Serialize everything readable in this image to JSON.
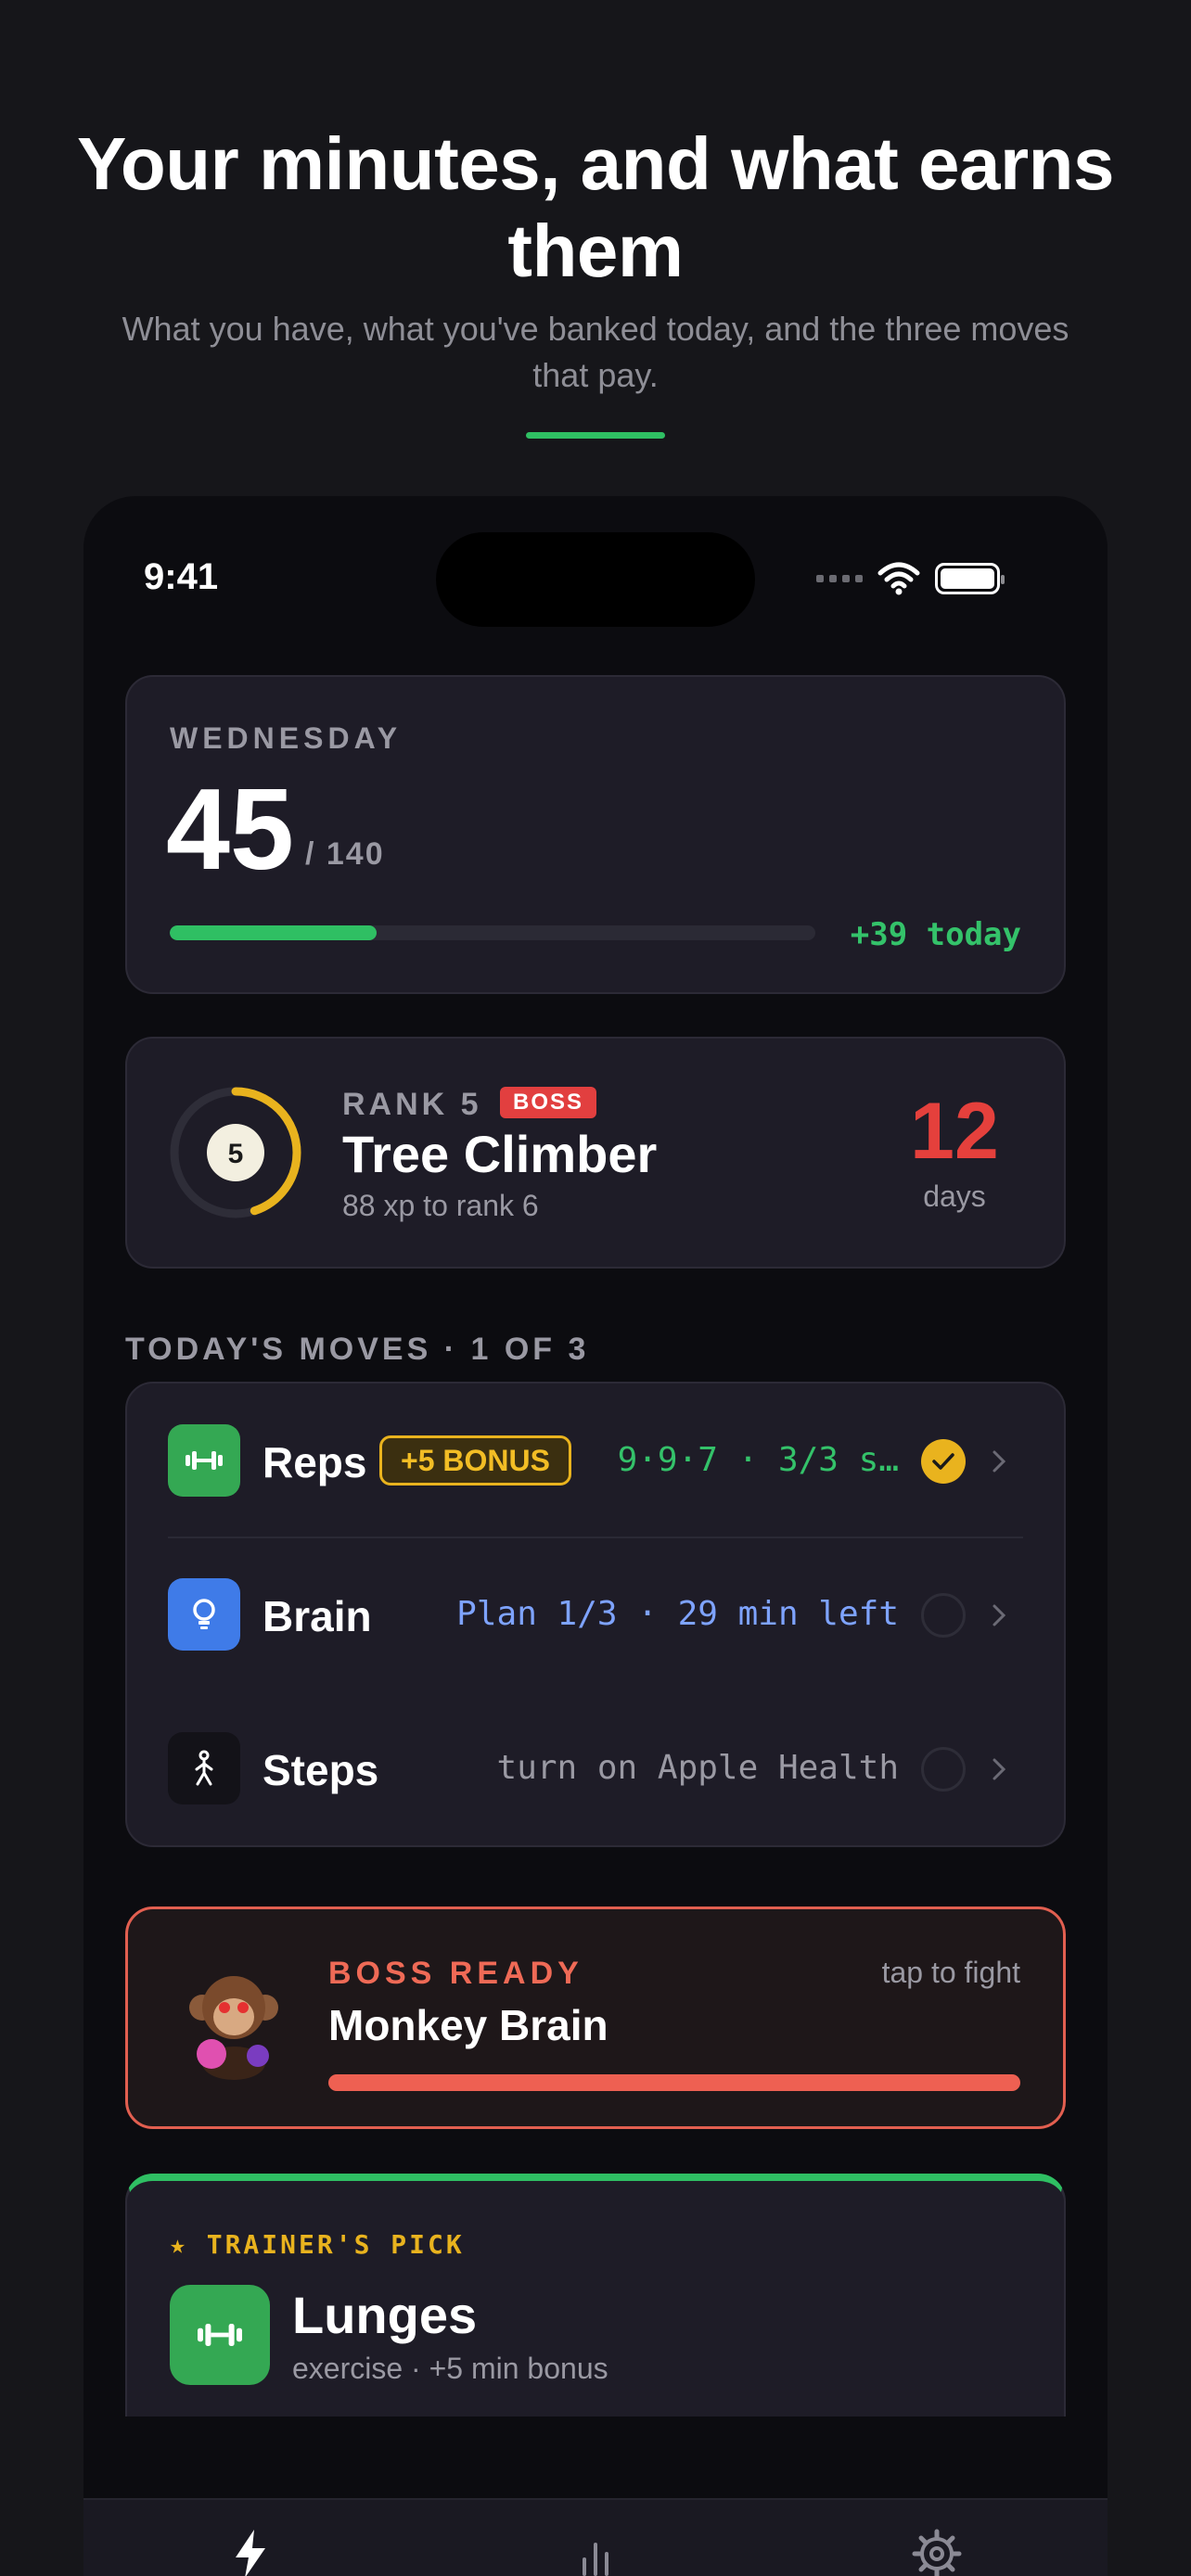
{
  "header": {
    "title": "Your minutes, and what earns them",
    "subtitle": "What you have, what you've banked today, and the three moves that pay."
  },
  "status_bar": {
    "time": "9:41"
  },
  "day_card": {
    "weekday": "WEDNESDAY",
    "minutes": "45",
    "total": "/ 140",
    "progress_fraction": 0.32,
    "today": "+39 today"
  },
  "rank_card": {
    "rank_label": "RANK 5",
    "badge": "BOSS",
    "ring_level": "5",
    "ring_progress_fraction": 0.45,
    "name": "Tree Climber",
    "xp": "88 xp to rank 6",
    "streak_value": "12",
    "streak_unit": "days"
  },
  "moves": {
    "heading": "TODAY'S MOVES · 1 OF 3",
    "items": [
      {
        "name": "Reps",
        "bonus": "+5 BONUS",
        "detail": "9·9·7 · 3/3 s…",
        "done": true,
        "icon": "dumbbell-icon",
        "icon_color": "#34a853",
        "detail_color": "#34c26a"
      },
      {
        "name": "Brain",
        "detail": "Plan 1/3 · 29 min left",
        "done": false,
        "icon": "lightbulb-icon",
        "icon_color": "#3f7be8",
        "detail_color": "#7ea3ff"
      },
      {
        "name": "Steps",
        "detail": "turn on Apple Health",
        "done": false,
        "icon": "walking-icon",
        "icon_color": "#1c1b22",
        "detail_color": "#9a99a3"
      }
    ]
  },
  "boss_card": {
    "label": "BOSS READY",
    "action": "tap to fight",
    "name": "Monkey Brain",
    "health_fraction": 1.0
  },
  "trainer_card": {
    "label": "★ TRAINER'S PICK",
    "name": "Lunges",
    "subtitle": "exercise · +5 min bonus"
  },
  "tabs": [
    "bolt-icon",
    "chart-icon",
    "gear-icon"
  ],
  "colors": {
    "accent_green": "#2fbf63",
    "boss_red": "#e5403c",
    "gold": "#e9b31e"
  }
}
